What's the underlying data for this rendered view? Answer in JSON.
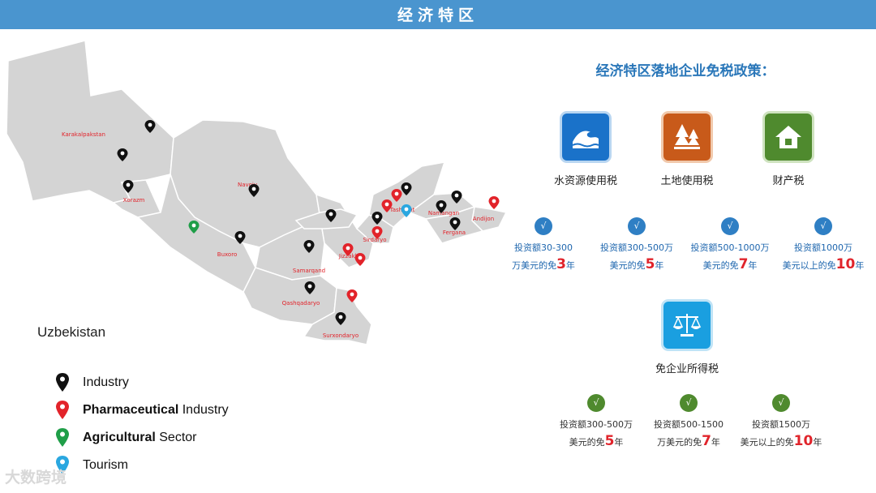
{
  "header": {
    "title": "经济特区"
  },
  "map": {
    "country": "Uzbekistan",
    "regions": [
      "Karakalpakstan",
      "Navoiy",
      "Xorazm",
      "Buxoro",
      "Samarqand",
      "Qashqadaryo",
      "Surxondaryo",
      "Tashkent",
      "Sirdaryo",
      "Jizzakh",
      "Namangan",
      "Andijon",
      "Fergana"
    ],
    "colors": {
      "industry": "#111111",
      "pharma": "#e2232a",
      "agri": "#1f9e48",
      "tourism": "#2aa7e0",
      "land": "#d4d4d4",
      "border": "#ffffff"
    }
  },
  "legend": [
    {
      "bold": "",
      "text": "Industry",
      "icon": "black-pin-icon"
    },
    {
      "bold": "Pharmaceutical",
      "text": " Industry",
      "icon": "red-pin-icon"
    },
    {
      "bold": "Agricultural",
      "text": " Sector",
      "icon": "green-pin-icon"
    },
    {
      "bold": "",
      "text": "Tourism",
      "icon": "blue-pin-icon"
    }
  ],
  "watermark": "大数跨境",
  "policy": {
    "title": "经济特区落地企业免税政策：",
    "taxes": [
      {
        "name": "水资源使用税",
        "icon": "water-wave-icon",
        "color": "#1a72c9"
      },
      {
        "name": "土地使用税",
        "icon": "tree-land-icon",
        "color": "#c85a1a"
      },
      {
        "name": "财产税",
        "icon": "house-icon",
        "color": "#4f8a2e"
      }
    ],
    "tiers_a": [
      {
        "pre": "投资额30-300",
        "pre2": "万美元的免",
        "num": "3",
        "post": "年"
      },
      {
        "pre": "投资额300-500万",
        "pre2": "美元的免",
        "num": "5",
        "post": "年"
      },
      {
        "pre": "投资额500-1000万",
        "pre2": "美元的免",
        "num": "7",
        "post": "年"
      },
      {
        "pre": "投资额1000万",
        "pre2": "美元以上的免",
        "num": "10",
        "post": "年"
      }
    ],
    "corp_tax": {
      "name": "免企业所得税",
      "icon": "scales-icon",
      "color": "#1a9fe0"
    },
    "tiers_b": [
      {
        "pre": "投资额300-500万",
        "pre2": "美元的免",
        "num": "5",
        "post": "年"
      },
      {
        "pre": "投资额500-1500",
        "pre2": "万美元的免",
        "num": "7",
        "post": "年"
      },
      {
        "pre": "投资额1500万",
        "pre2": "美元以上的免",
        "num": "10",
        "post": "年"
      }
    ]
  }
}
